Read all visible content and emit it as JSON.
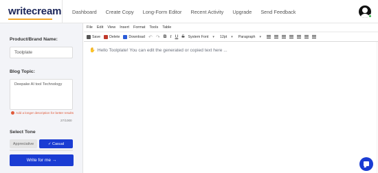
{
  "header": {
    "logo_part1": "write",
    "logo_part2": "cream",
    "nav": [
      "Dashboard",
      "Create Copy",
      "Long-Form Editor",
      "Recent Activity",
      "Upgrade",
      "Send Feedback"
    ]
  },
  "sidebar": {
    "product_label": "Product/Brand Name:",
    "product_value": "Toolplate",
    "topic_label": "Blog Topic:",
    "topic_value": "Deepake AI tool Technology",
    "warning": "Add a longer description for better results",
    "char_count": "27/1000",
    "tone_label": "Select Tone",
    "tones": [
      {
        "label": "Appreciative",
        "selected": false
      },
      {
        "label": "✓ Casual",
        "selected": true
      }
    ],
    "write_button": "Write for me →"
  },
  "editor": {
    "menu": [
      "File",
      "Edit",
      "View",
      "Insert",
      "Format",
      "Tools",
      "Table"
    ],
    "toolbar": {
      "save": "Save",
      "delete": "Delete",
      "download": "Download",
      "font": "System Font",
      "size": "12pt",
      "block": "Paragraph"
    },
    "content": "Hello Toolplate! You can edit the generated or copied text here ..."
  },
  "colors": {
    "primary": "#1a3cd3",
    "logo_accent": "#f5a623",
    "warning": "#e05a3a"
  }
}
